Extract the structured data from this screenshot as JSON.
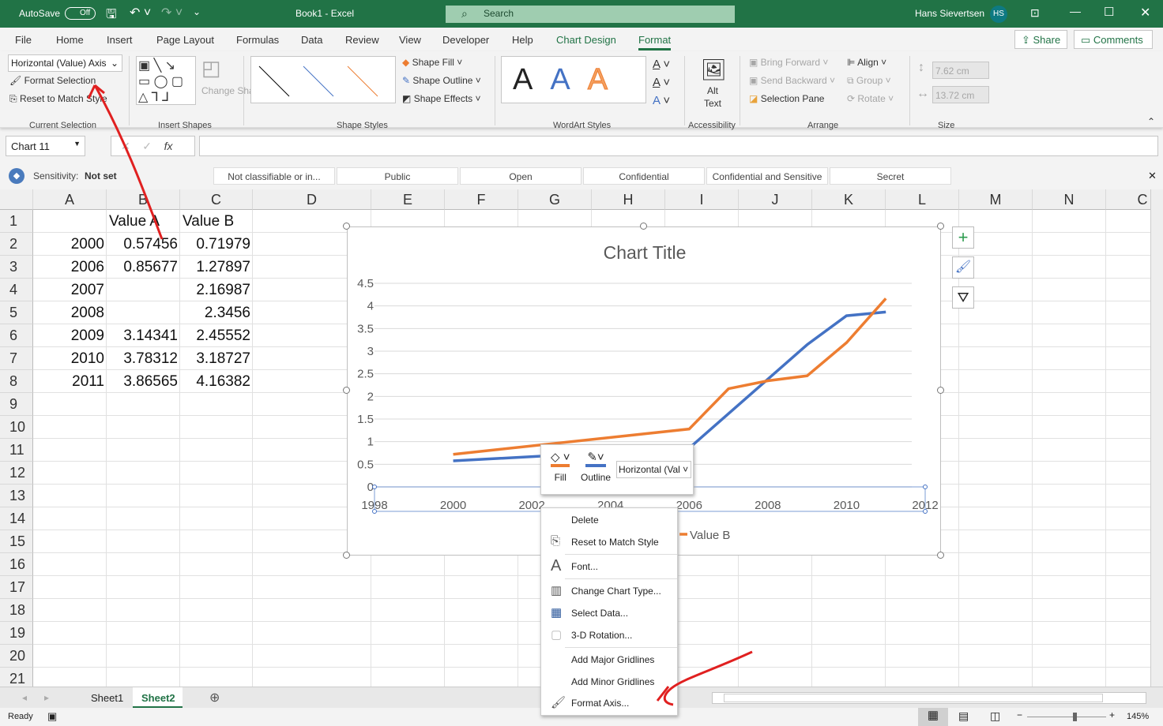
{
  "titlebar": {
    "autosave": "AutoSave",
    "autosave_state": "Off",
    "title": "Book1  -  Excel",
    "search": "Search",
    "user": "Hans Sievertsen",
    "initials": "HS"
  },
  "tabs": [
    "File",
    "Home",
    "Insert",
    "Page Layout",
    "Formulas",
    "Data",
    "Review",
    "View",
    "Developer",
    "Help",
    "Chart Design",
    "Format"
  ],
  "active_tab": "Format",
  "share": "Share",
  "comments": "Comments",
  "ribbon": {
    "current_selection": {
      "dropdown": "Horizontal (Value) Axis",
      "format_selection": "Format Selection",
      "reset": "Reset to Match Style",
      "label": "Current Selection"
    },
    "insert_shapes": {
      "change_shape": "Change Shape",
      "label": "Insert Shapes"
    },
    "shape_styles": {
      "fill": "Shape Fill",
      "outline": "Shape Outline",
      "effects": "Shape Effects",
      "label": "Shape Styles"
    },
    "wordart": {
      "label": "WordArt Styles",
      "letter": "A"
    },
    "accessibility": {
      "alt_text": "Alt Text",
      "label": "Accessibility"
    },
    "arrange": {
      "bring_forward": "Bring Forward",
      "send_backward": "Send Backward",
      "selection_pane": "Selection Pane",
      "align": "Align",
      "group": "Group",
      "rotate": "Rotate",
      "label": "Arrange"
    },
    "size": {
      "height": "7.62 cm",
      "width": "13.72 cm",
      "label": "Size"
    }
  },
  "formula_bar": {
    "name_box": "Chart 11",
    "fx": "fx",
    "value": ""
  },
  "sensitivity": {
    "label": "Sensitivity:",
    "value": "Not set",
    "options": [
      "Not classifiable or in...",
      "Public",
      "Open",
      "Confidential",
      "Confidential and Sensitive",
      "Secret"
    ]
  },
  "columns": [
    "A",
    "B",
    "C",
    "D",
    "E",
    "F",
    "G",
    "H",
    "I",
    "J",
    "K",
    "L",
    "M",
    "N",
    "C"
  ],
  "rows": [
    "1",
    "2",
    "3",
    "4",
    "5",
    "6",
    "7",
    "8",
    "9",
    "10",
    "11",
    "12",
    "13",
    "14",
    "15",
    "16",
    "17",
    "18",
    "19",
    "20",
    "21"
  ],
  "cells": [
    [
      "",
      "Value A",
      "Value B"
    ],
    [
      "2000",
      "0.57456",
      "0.71979"
    ],
    [
      "2006",
      "0.85677",
      "1.27897"
    ],
    [
      "2007",
      "",
      "2.16987"
    ],
    [
      "2008",
      "",
      "2.3456"
    ],
    [
      "2009",
      "3.14341",
      "2.45552"
    ],
    [
      "2010",
      "3.78312",
      "3.18727"
    ],
    [
      "2011",
      "3.86565",
      "4.16382"
    ]
  ],
  "chart_data": {
    "type": "scatter",
    "title": "Chart Title",
    "x_ticks": [
      "1998",
      "2000",
      "2002",
      "2004",
      "2006",
      "2008",
      "2010",
      "2012"
    ],
    "y_ticks": [
      "0",
      "0.5",
      "1",
      "1.5",
      "2",
      "2.5",
      "3",
      "3.5",
      "4",
      "4.5"
    ],
    "xlim": [
      1998,
      2012
    ],
    "ylim": [
      0,
      4.5
    ],
    "series": [
      {
        "name": "Value A",
        "color": "#4472c4",
        "x": [
          2000,
          2006,
          2009,
          2010,
          2011
        ],
        "y": [
          0.57456,
          0.85677,
          3.14341,
          3.78312,
          3.86565
        ]
      },
      {
        "name": "Value B",
        "color": "#ed7d31",
        "x": [
          2000,
          2006,
          2007,
          2008,
          2009,
          2010,
          2011
        ],
        "y": [
          0.71979,
          1.27897,
          2.16987,
          2.3456,
          2.45552,
          3.18727,
          4.16382
        ]
      }
    ],
    "legend": "bottom"
  },
  "mini_toolbar": {
    "fill": "Fill",
    "outline": "Outline",
    "dropdown": "Horizontal (Val"
  },
  "context_menu": [
    "Delete",
    "Reset to Match Style",
    "Font...",
    "Change Chart Type...",
    "Select Data...",
    "3-D Rotation...",
    "Add Major Gridlines",
    "Add Minor Gridlines",
    "Format Axis..."
  ],
  "sheets": [
    "Sheet1",
    "Sheet2"
  ],
  "active_sheet": "Sheet2",
  "status": {
    "ready": "Ready",
    "zoom": "145%",
    "zoom_fraction": 0.6
  }
}
